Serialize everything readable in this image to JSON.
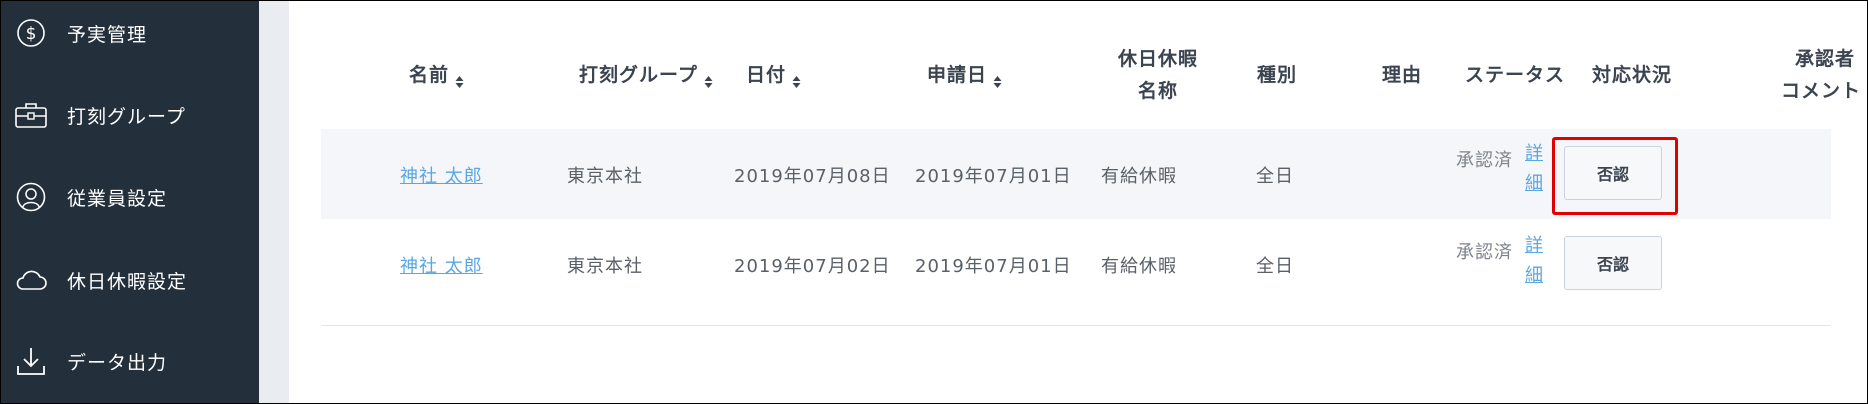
{
  "sidebar": {
    "items": [
      {
        "label": "予実管理",
        "icon": "dollar-circle-icon"
      },
      {
        "label": "打刻グループ",
        "icon": "briefcase-icon"
      },
      {
        "label": "従業員設定",
        "icon": "user-icon"
      },
      {
        "label": "休日休暇設定",
        "icon": "cloud-icon"
      },
      {
        "label": "データ出力",
        "icon": "download-icon"
      }
    ]
  },
  "table": {
    "headers": {
      "name": "名前",
      "group": "打刻グループ",
      "date": "日付",
      "applied": "申請日",
      "holiday_name_1": "休日休暇",
      "holiday_name_2": "名称",
      "type": "種別",
      "reason": "理由",
      "status": "ステータス",
      "action": "対応状況",
      "approver_1": "承認者",
      "approver_2": "コメント"
    },
    "rows": [
      {
        "name": "神社 太郎",
        "group": "東京本社",
        "date": "2019年07月08日",
        "applied": "2019年07月01日",
        "holiday": "有給休暇",
        "type": "全日",
        "status": "承認済",
        "detail_1": "詳",
        "detail_2": "細",
        "deny": "否認"
      },
      {
        "name": "神社 太郎",
        "group": "東京本社",
        "date": "2019年07月02日",
        "applied": "2019年07月01日",
        "holiday": "有給休暇",
        "type": "全日",
        "status": "承認済",
        "detail_1": "詳",
        "detail_2": "細",
        "deny": "否認"
      }
    ]
  },
  "colors": {
    "sidebar_bg": "#232f3a",
    "link": "#5ba7e2",
    "highlight": "#e00000",
    "row_alt": "#f5f6f9"
  }
}
